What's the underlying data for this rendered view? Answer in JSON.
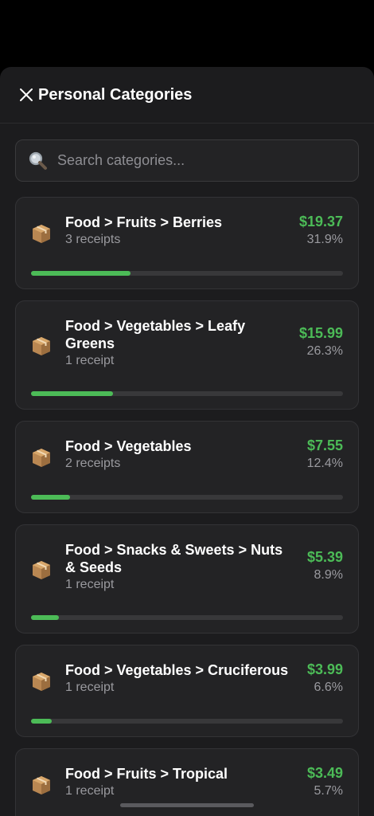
{
  "header": {
    "title": "Personal Categories"
  },
  "search": {
    "placeholder": "Search categories..."
  },
  "categories": [
    {
      "icon": "package-icon",
      "name": "Food > Fruits > Berries",
      "count": "3 receipts",
      "amount": "$19.37",
      "percent": "31.9%",
      "share": 0.319
    },
    {
      "icon": "package-icon",
      "name": "Food > Vegetables > Leafy Greens",
      "count": "1 receipt",
      "amount": "$15.99",
      "percent": "26.3%",
      "share": 0.263
    },
    {
      "icon": "package-icon",
      "name": "Food > Vegetables",
      "count": "2 receipts",
      "amount": "$7.55",
      "percent": "12.4%",
      "share": 0.124
    },
    {
      "icon": "package-icon",
      "name": "Food > Snacks & Sweets > Nuts & Seeds",
      "count": "1 receipt",
      "amount": "$5.39",
      "percent": "8.9%",
      "share": 0.089
    },
    {
      "icon": "package-icon",
      "name": "Food > Vegetables > Cruciferous",
      "count": "1 receipt",
      "amount": "$3.99",
      "percent": "6.6%",
      "share": 0.066
    },
    {
      "icon": "package-icon",
      "name": "Food > Fruits > Tropical",
      "count": "1 receipt",
      "amount": "$3.49",
      "percent": "5.7%",
      "share": 0.057
    }
  ],
  "colors": {
    "accent": "#4cbb57",
    "background": "#1c1c1e",
    "card": "#232325",
    "track": "#38383a"
  }
}
